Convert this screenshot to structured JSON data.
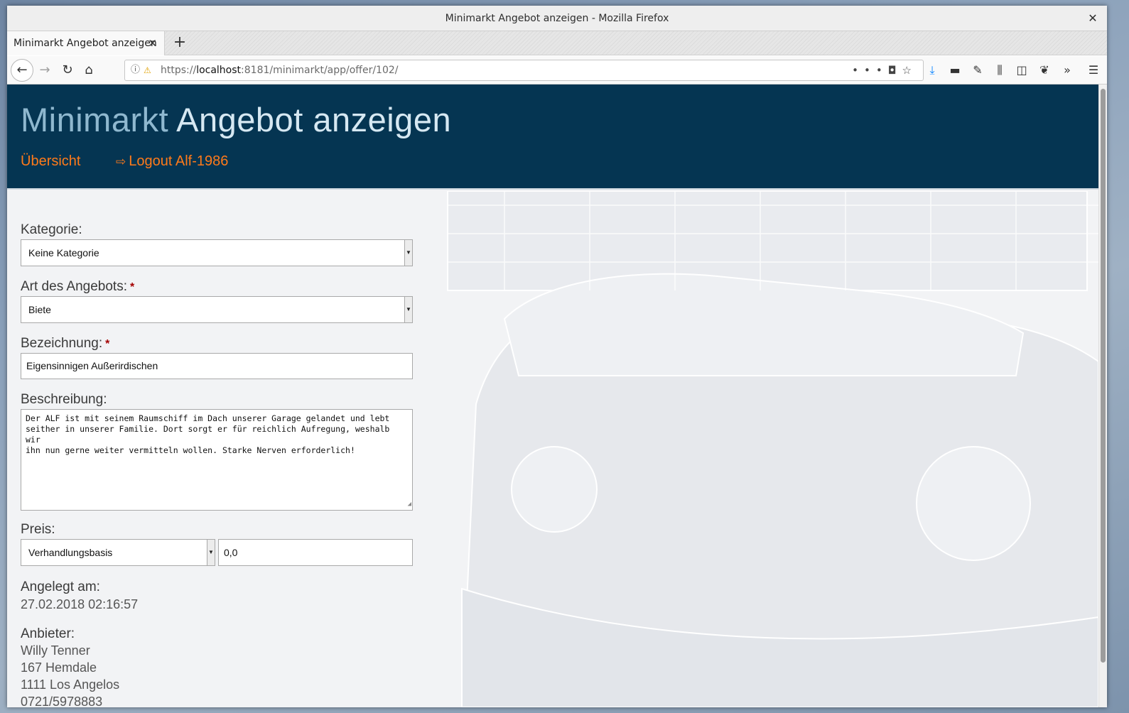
{
  "browser": {
    "window_title": "Minimarkt Angebot anzeigen - Mozilla Firefox",
    "tab_title": "Minimarkt Angebot anzeigen",
    "url_prefix": "https://",
    "url_host": "localhost",
    "url_rest": ":8181/minimarkt/app/offer/102/",
    "icons": {
      "back": "back-arrow-icon",
      "forward": "forward-arrow-icon",
      "reload": "reload-icon",
      "home": "home-icon",
      "download": "download-icon",
      "menu": "hamburger-menu-icon"
    }
  },
  "site": {
    "brand": "Minimarkt",
    "page_title": "Angebot anzeigen",
    "nav": {
      "overview": "Übersicht",
      "logout": "Logout Alf-1986"
    },
    "colors": {
      "header_bg": "#053552",
      "brand_text": "#8fb8cf",
      "title_text": "#d6e8f2",
      "link": "#ff7a1a",
      "required": "#a40000"
    }
  },
  "form": {
    "category": {
      "label": "Kategorie:",
      "value": "Keine Kategorie"
    },
    "offer_type": {
      "label": "Art des Angebots:",
      "required_mark": "*",
      "value": "Biete"
    },
    "name": {
      "label": "Bezeichnung:",
      "required_mark": "*",
      "value": "Eigensinnigen Außerirdischen"
    },
    "description": {
      "label": "Beschreibung:",
      "value": "Der ALF ist mit seinem Raumschiff im Dach unserer Garage gelandet und lebt\nseither in unserer Familie. Dort sorgt er für reichlich Aufregung, weshalb wir\nihn nun gerne weiter vermitteln wollen. Starke Nerven erforderlich!"
    },
    "price": {
      "label": "Preis:",
      "type_value": "Verhandlungsbasis",
      "amount": "0,0"
    },
    "created": {
      "label": "Angelegt am:",
      "value": "27.02.2018 02:16:57"
    },
    "seller": {
      "label": "Anbieter:",
      "name": "Willy Tenner",
      "street": "167 Hemdale",
      "city": "1111 Los Angelos",
      "phone": "0721/5978883"
    }
  }
}
